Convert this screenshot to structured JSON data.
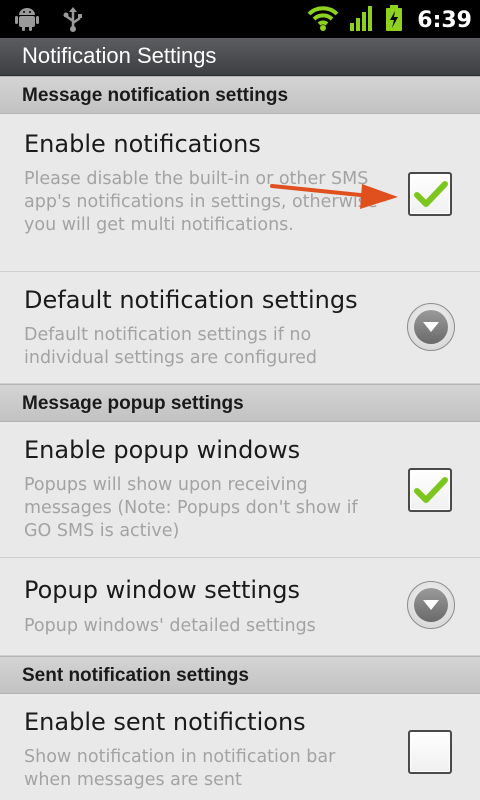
{
  "status_bar": {
    "time": "6:39",
    "icons": [
      "android-icon",
      "usb-icon",
      "wifi-icon",
      "signal-icon",
      "battery-charging-icon"
    ]
  },
  "title_bar": {
    "title": "Notification Settings"
  },
  "sections": [
    {
      "header": "Message notification settings",
      "rows": [
        {
          "title": "Enable notifications",
          "desc": "Please disable the built-in or other SMS app's notifications in settings, otherwise you will get multi notifications.",
          "control": "checkbox",
          "checked": true
        },
        {
          "title": "Default notification settings",
          "desc": "Default notification settings if no individual settings are configured",
          "control": "dropdown"
        }
      ]
    },
    {
      "header": "Message popup settings",
      "rows": [
        {
          "title": "Enable popup windows",
          "desc": "Popups will show upon receiving messages (Note: Popups don't show if GO SMS is active)",
          "control": "checkbox",
          "checked": true
        },
        {
          "title": "Popup window settings",
          "desc": "Popup windows' detailed settings",
          "control": "dropdown"
        }
      ]
    },
    {
      "header": "Sent notification settings",
      "rows": [
        {
          "title": "Enable sent notifictions",
          "desc": "Show notification in notification bar when messages are sent",
          "control": "checkbox",
          "checked": false
        }
      ]
    }
  ],
  "colors": {
    "accent_check": "#7cc61f",
    "annotation_arrow": "#e0501e",
    "status_green": "#8ed11f"
  }
}
